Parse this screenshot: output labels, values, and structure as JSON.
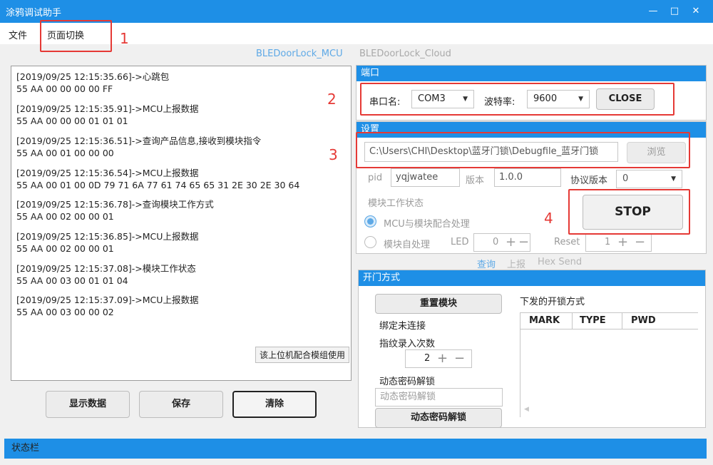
{
  "window": {
    "title": "涂鸦调试助手",
    "minimize": "—",
    "maximize": "□",
    "close": "✕"
  },
  "menu": {
    "file": "文件",
    "page_switch": "页面切换"
  },
  "annotations": [
    "1",
    "2",
    "3",
    "4"
  ],
  "top_tabs": {
    "mcu": "BLEDoorLock_MCU",
    "cloud": "BLEDoorLock_Cloud"
  },
  "log": {
    "entries": [
      {
        "time": "[2019/09/25 12:15:35.66]->心跳包",
        "hex": "55 AA 00 00 00 00 FF"
      },
      {
        "time": "[2019/09/25 12:15:35.91]->MCU上报数据",
        "hex": "55 AA 00 00 00 01 01 01"
      },
      {
        "time": "[2019/09/25 12:15:36.51]->查询产品信息,接收到模块指令",
        "hex": "55 AA 00 01 00 00 00"
      },
      {
        "time": "[2019/09/25 12:15:36.54]->MCU上报数据",
        "hex": "55 AA 00 01 00 0D 79 71 6A 77 61 74 65 65 31 2E 30 2E 30 64"
      },
      {
        "time": "[2019/09/25 12:15:36.78]->查询模块工作方式",
        "hex": "55 AA 00 02 00 00 01"
      },
      {
        "time": "[2019/09/25 12:15:36.85]->MCU上报数据",
        "hex": "55 AA 00 02 00 00 01"
      },
      {
        "time": "[2019/09/25 12:15:37.08]->模块工作状态",
        "hex": "55 AA 00 03 00 01 01 04"
      },
      {
        "time": "[2019/09/25 12:15:37.09]->MCU上报数据",
        "hex": "55 AA 00 03 00 00 02"
      }
    ],
    "tag": "该上位机配合模组使用"
  },
  "bottom_buttons": {
    "show_data": "显示数据",
    "save": "保存",
    "clear": "清除"
  },
  "port": {
    "header": "端口",
    "port_label": "串口名:",
    "port_value": "COM3",
    "baud_label": "波特率:",
    "baud_value": "9600",
    "close_button": "CLOSE"
  },
  "settings": {
    "header": "设置",
    "path": "C:\\Users\\CHI\\Desktop\\蓝牙门锁\\Debugfile_蓝牙门锁",
    "browse": "浏览",
    "pid_label": "pid",
    "pid_value": "yqjwatee",
    "version_label": "版本",
    "version_value": "1.0.0",
    "protocol_label": "协议版本",
    "protocol_value": "0",
    "work_state_label": "模块工作状态",
    "radio_mcu": "MCU与模块配合处理",
    "radio_self": "模块自处理",
    "led_label": "LED",
    "led_value": "0",
    "reset_label": "Reset",
    "reset_value": "1",
    "stop_button": "STOP"
  },
  "sub_tabs": {
    "query": "查询",
    "report": "上报",
    "hex_send": "Hex Send"
  },
  "door": {
    "header": "开门方式",
    "reset_module": "重置模块",
    "bind_status": "绑定未连接",
    "fingerprint_label": "指纹录入次数",
    "fingerprint_value": "2",
    "dynamic_pwd_label": "动态密码解锁",
    "dynamic_pwd_placeholder": "动态密码解锁",
    "dynamic_pwd_button": "动态密码解锁",
    "unlock_methods_label": "下发的开锁方式",
    "columns": [
      "MARK",
      "TYPE",
      "PWD"
    ]
  },
  "status_bar": "状态栏",
  "colors": {
    "titlebar": "#1e8fe6",
    "annotation": "#e53935",
    "radio_checked": "#5ea9e6"
  }
}
